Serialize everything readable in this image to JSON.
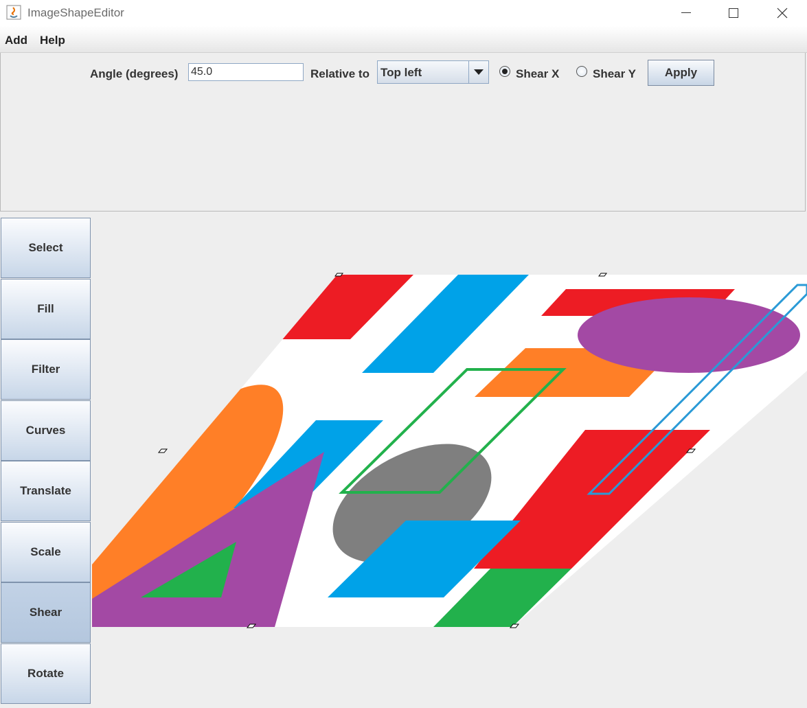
{
  "window": {
    "title": "ImageShapeEditor"
  },
  "menu": {
    "items": [
      "Add",
      "Help"
    ]
  },
  "options": {
    "angle_label": "Angle (degrees)",
    "angle_value": "45.0",
    "relative_label": "Relative to",
    "relative_value": "Top left",
    "shear_x_label": "Shear X",
    "shear_y_label": "Shear Y",
    "selected_shear": "Shear X",
    "apply_label": "Apply"
  },
  "tools": {
    "items": [
      "Select",
      "Fill",
      "Filter",
      "Curves",
      "Translate",
      "Scale",
      "Shear",
      "Rotate"
    ],
    "active": "Shear"
  },
  "colors": {
    "red": "#ed1c24",
    "blue": "#00a2e8",
    "orange": "#ff7f27",
    "purple": "#a349a4",
    "green": "#22b14c",
    "gray": "#7f7f7f",
    "canvas_bg": "#ffffff",
    "outline_blue": "#2a9ad6"
  }
}
